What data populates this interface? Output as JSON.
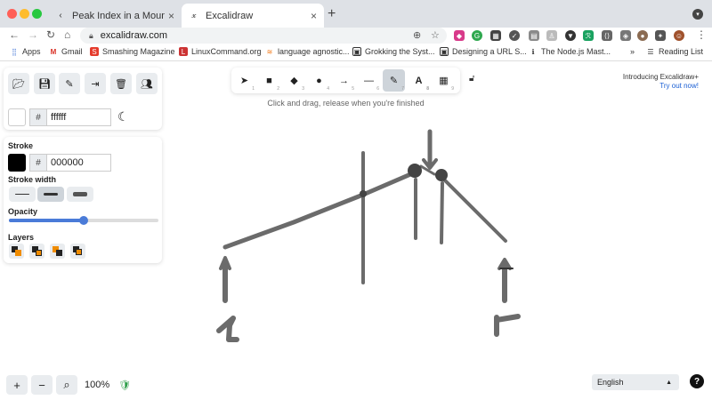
{
  "browser": {
    "tabs": [
      {
        "title": "Peak Index in a Mountain Array",
        "active": false
      },
      {
        "title": "Excalidraw",
        "active": true
      }
    ],
    "url": "excalidraw.com",
    "bookmarks": [
      {
        "label": "Apps",
        "icon": "grid-icon"
      },
      {
        "label": "Gmail",
        "icon": "gmail-icon"
      },
      {
        "label": "Smashing Magazine",
        "icon": "smashing-icon"
      },
      {
        "label": "LinuxCommand.org",
        "icon": "linux-icon"
      },
      {
        "label": "language agnostic...",
        "icon": "stack-icon"
      },
      {
        "label": "Grokking the Syst...",
        "icon": "grok-icon"
      },
      {
        "label": "Designing a URL S...",
        "icon": "grok-icon"
      },
      {
        "label": "The Node.js Mast...",
        "icon": "info-icon"
      },
      {
        "label": "Reading List",
        "icon": "reading-list-icon"
      }
    ],
    "more_bookmarks": "»"
  },
  "app": {
    "background_hex": "ffffff",
    "stroke_hex": "000000",
    "labels": {
      "stroke": "Stroke",
      "stroke_width": "Stroke width",
      "opacity": "Opacity",
      "layers": "Layers"
    },
    "opacity_fraction": 0.5,
    "hint": "Click and drag, release when you're finished",
    "promo": {
      "line1": "Introducing Excalidraw+",
      "link": "Try out now!"
    },
    "zoom": "100%",
    "language": "English",
    "help": "?",
    "tools": [
      {
        "name": "selection",
        "num": "1"
      },
      {
        "name": "rectangle",
        "num": "2"
      },
      {
        "name": "diamond",
        "num": "3"
      },
      {
        "name": "ellipse",
        "num": "4"
      },
      {
        "name": "arrow",
        "num": "5"
      },
      {
        "name": "line",
        "num": "6"
      },
      {
        "name": "draw",
        "num": "7"
      },
      {
        "name": "text",
        "num": "8"
      },
      {
        "name": "library",
        "num": "9"
      }
    ]
  },
  "colors": {
    "accent": "#4a7bd8",
    "stroke_color": "#000000",
    "drawing": "#6b6b6b"
  }
}
